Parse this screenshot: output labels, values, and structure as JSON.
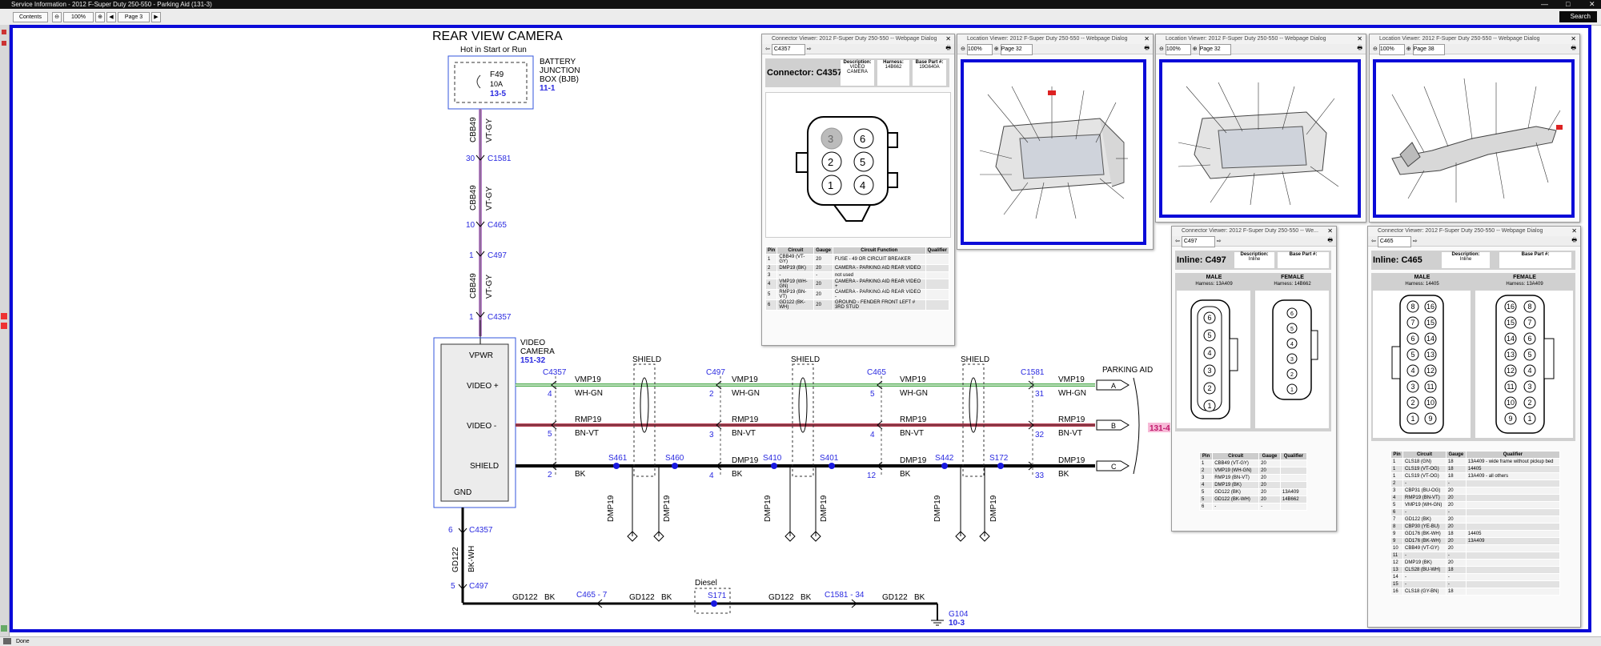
{
  "window": {
    "title": "Service Information - 2012 F-Super Duty 250-550 - Parking Aid (131-3)",
    "search_label": "Search",
    "status": "Done"
  },
  "toolbar": {
    "contents": "Contents",
    "zoom": "100%",
    "page": "Page 3"
  },
  "diagram": {
    "title": "REAR VIEW CAMERA",
    "hot_in": "Hot in Start or Run",
    "fuse": {
      "id": "F49",
      "rating": "10A",
      "ref": "13-5"
    },
    "bjb": {
      "line1": "BATTERY",
      "line2": "JUNCTION",
      "line3": "BOX (BJB)",
      "ref": "11-1"
    },
    "vertical_circuit": {
      "name": "CBB49",
      "color": "VT-GY"
    },
    "connectors": [
      {
        "pin": "30",
        "name": "C1581"
      },
      {
        "pin": "10",
        "name": "C465"
      },
      {
        "pin": "1",
        "name": "C497"
      },
      {
        "pin": "1",
        "name": "C4357"
      }
    ],
    "camera": {
      "label1": "VIDEO",
      "label2": "CAMERA",
      "ref": "151-32",
      "vpwr": "VPWR",
      "video_plus": "VIDEO +",
      "video_minus": "VIDEO -",
      "shield": "SHIELD",
      "gnd": "GND"
    },
    "shield_label": "SHIELD",
    "parking_aid": {
      "label": "PARKING AID",
      "ref": "131-4",
      "a": "A",
      "b": "B",
      "c": "C"
    },
    "wire_vmp": {
      "name": "VMP19",
      "color": "WH-GN"
    },
    "wire_rmp": {
      "name": "RMP19",
      "color": "BN-VT"
    },
    "wire_dmp": {
      "name": "DMP19",
      "color": "BK"
    },
    "conn_c4357": "C4357",
    "conn_c497": "C497",
    "conn_c465": "C465",
    "conn_c1581": "C1581",
    "pins_c4357": [
      "4",
      "5",
      "2"
    ],
    "pins_c497": [
      "2",
      "3",
      "4"
    ],
    "pins_c465": [
      "5",
      "4",
      "12"
    ],
    "pins_c1581": [
      "31",
      "32",
      "33"
    ],
    "splices": [
      "S461",
      "S460",
      "S410",
      "S401",
      "S442",
      "S172"
    ],
    "ground": {
      "pin_top": "6",
      "conn_top": "C4357",
      "pin_bottom": "5",
      "conn_bottom": "C497",
      "circuit": "GD122",
      "color": "BK-WH",
      "gd122": "GD122",
      "bk": "BK",
      "c465_7": "C465 - 7",
      "diesel": "Diesel",
      "s171": "S171",
      "c1581_34": "C1581 - 34",
      "g104": "G104",
      "g104_ref": "10-3"
    }
  },
  "dialogs": {
    "c4357": {
      "title": "Connector Viewer: 2012 F-Super Duty 250-550 -- Webpage Dialog",
      "select": "C4357",
      "connector_label": "Connector: C4357",
      "desc_label": "Description:",
      "desc": "VIDEO CAMERA",
      "harness_label": "Harness:",
      "harness": "14B662",
      "base_label": "Base Part #:",
      "base": "19G640A",
      "pins_drawn": [
        "3",
        "6",
        "2",
        "5",
        "1",
        "4"
      ],
      "headers": [
        "Pin",
        "Circuit",
        "Gauge",
        "Circuit Function",
        "Qualifier"
      ],
      "rows": [
        [
          "1",
          "CBB49 (VT-GY)",
          "20",
          "FUSE - 49 OR CIRCUIT BREAKER",
          ""
        ],
        [
          "2",
          "DMP19 (BK)",
          "20",
          "CAMERA - PARKING AID REAR VIDEO",
          ""
        ],
        [
          "3",
          "-",
          "-",
          "not used",
          ""
        ],
        [
          "4",
          "VMP19 (WH-GN)",
          "20",
          "CAMERA - PARKING AID REAR VIDEO +",
          ""
        ],
        [
          "5",
          "RMP19 (BN-VT)",
          "20",
          "CAMERA - PARKING AID REAR VIDEO -",
          ""
        ],
        [
          "6",
          "GD122 (BK-WH)",
          "20",
          "GROUND - FENDER FRONT LEFT # 3RD STUD",
          ""
        ]
      ]
    },
    "loc1": {
      "title": "Location Viewer: 2012 F-Super Duty 250-550 -- Webpage Dialog",
      "zoom": "100%",
      "page": "Page 32"
    },
    "loc2": {
      "title": "Location Viewer: 2012 F-Super Duty 250-550 -- Webpage Dialog",
      "zoom": "100%",
      "page": "Page 32"
    },
    "loc3": {
      "title": "Location Viewer: 2012 F-Super Duty 250-550 -- Webpage Dialog",
      "zoom": "100%",
      "page": "Page 38"
    },
    "c497": {
      "title": "Connector Viewer: 2012 F-Super Duty 250-550 -- We...",
      "select": "C497",
      "inline_label": "Inline: C497",
      "desc_label": "Description:",
      "desc": "Inline",
      "base_label": "Base Part #:",
      "male": "MALE",
      "male_harness": "Harness: 13A409",
      "female": "FEMALE",
      "female_harness": "Harness: 14B662",
      "pins_drawn": [
        "6",
        "5",
        "4",
        "3",
        "2",
        "1"
      ],
      "headers": [
        "Pin",
        "Circuit",
        "Gauge",
        "Qualifier"
      ],
      "rows": [
        [
          "1",
          "CBB49 (VT-GY)",
          "20",
          ""
        ],
        [
          "2",
          "VMP19 (WH-GN)",
          "20",
          ""
        ],
        [
          "3",
          "RMP19 (BN-VT)",
          "20",
          ""
        ],
        [
          "4",
          "DMP19 (BK)",
          "20",
          ""
        ],
        [
          "5",
          "GD122 (BK)",
          "20",
          "13A409"
        ],
        [
          "5",
          "GD122 (BK-WH)",
          "20",
          "14B662"
        ],
        [
          "6",
          "-",
          "-",
          ""
        ]
      ]
    },
    "c465": {
      "title": "Connector Viewer: 2012 F-Super Duty 250-550 -- Webpage Dialog",
      "select": "C465",
      "inline_label": "Inline: C465",
      "desc_label": "Description:",
      "desc": "Inline",
      "base_label": "Base Part #:",
      "male": "MALE",
      "male_harness": "Harness: 14405",
      "female": "FEMALE",
      "female_harness": "Harness: 13A409",
      "male_pins": [
        "8",
        "16",
        "7",
        "15",
        "6",
        "14",
        "5",
        "13",
        "4",
        "12",
        "3",
        "11",
        "2",
        "10",
        "1",
        "9"
      ],
      "female_pins": [
        "16",
        "8",
        "15",
        "7",
        "14",
        "6",
        "13",
        "5",
        "12",
        "4",
        "11",
        "3",
        "10",
        "2",
        "9",
        "1"
      ],
      "headers": [
        "Pin",
        "Circuit",
        "Gauge",
        "Qualifier"
      ],
      "rows": [
        [
          "1",
          "CLS18 (GN)",
          "18",
          "13A409 - wide frame without pickup bed"
        ],
        [
          "1",
          "CLS19 (VT-OG)",
          "18",
          "14405"
        ],
        [
          "1",
          "CLS19 (VT-OG)",
          "18",
          "13A409 - all others"
        ],
        [
          "2",
          "-",
          "-",
          ""
        ],
        [
          "3",
          "CBP31 (BU-OG)",
          "20",
          ""
        ],
        [
          "4",
          "RMP19 (BN-VT)",
          "20",
          ""
        ],
        [
          "5",
          "VMP19 (WH-GN)",
          "20",
          ""
        ],
        [
          "6",
          "-",
          "-",
          ""
        ],
        [
          "7",
          "GD122 (BK)",
          "20",
          ""
        ],
        [
          "8",
          "CBP30 (YE-BU)",
          "20",
          ""
        ],
        [
          "9",
          "GD176 (BK-WH)",
          "18",
          "14405"
        ],
        [
          "9",
          "GD176 (BK-WH)",
          "20",
          "13A409"
        ],
        [
          "10",
          "CBB49 (VT-GY)",
          "20",
          ""
        ],
        [
          "11",
          "-",
          "-",
          ""
        ],
        [
          "12",
          "DMP19 (BK)",
          "20",
          ""
        ],
        [
          "13",
          "CLS28 (BU-WH)",
          "18",
          ""
        ],
        [
          "14",
          "-",
          "-",
          ""
        ],
        [
          "15",
          "-",
          "-",
          ""
        ],
        [
          "16",
          "CLS18 (GY-BN)",
          "18",
          ""
        ]
      ]
    }
  },
  "colors": {
    "frame_blue": "#0a0ad8",
    "link_blue": "#2a2ae0",
    "violet": "#b982c9",
    "red_wire": "#b53a4f",
    "green_wire": "#4caa4c",
    "highlight_pink": "#e83a8c"
  }
}
